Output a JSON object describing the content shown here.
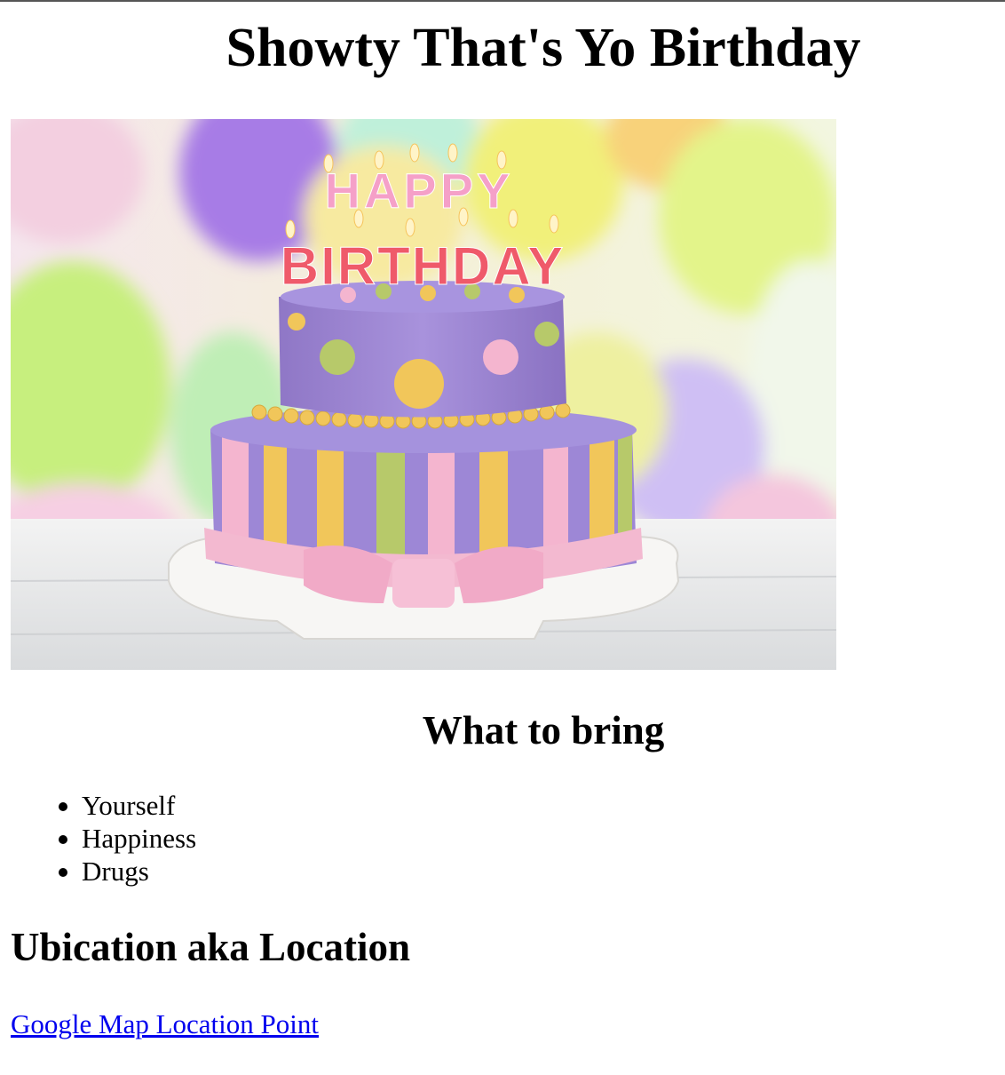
{
  "page": {
    "title": "Showty That's Yo Birthday"
  },
  "hero_image": {
    "description": "birthday-cake-photo",
    "candle_text_top": "HAPPY",
    "candle_text_bottom": "BIRTHDAY"
  },
  "bring_section": {
    "heading": "What to bring",
    "items": [
      "Yourself",
      "Happiness",
      "Drugs"
    ]
  },
  "location_section": {
    "heading": "Ubication aka Location",
    "link_label": "Google Map Location Point"
  },
  "colors": {
    "link": "#0000ee",
    "cake_purple": "#9a82d2",
    "cake_pink": "#f4b5cf",
    "cake_yellow": "#f1c65a",
    "cake_green": "#b7c96a"
  }
}
